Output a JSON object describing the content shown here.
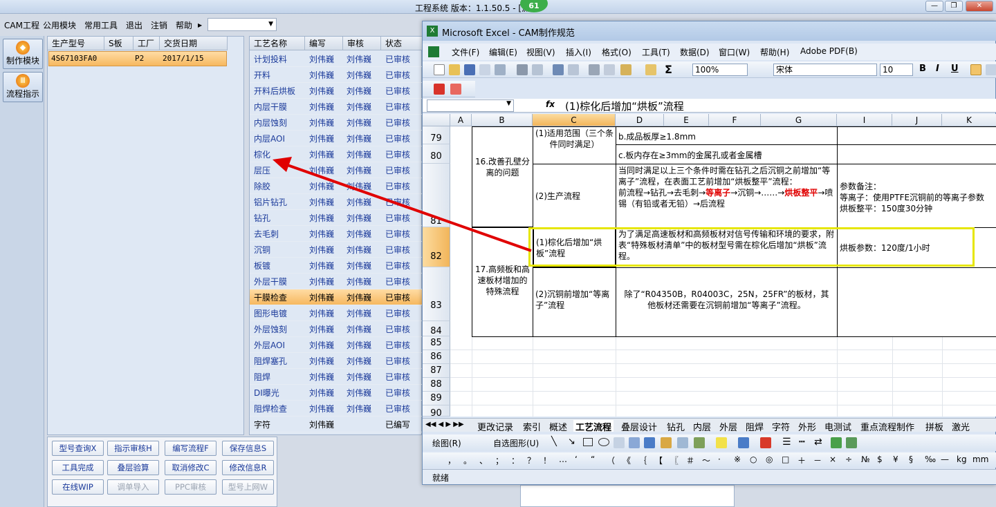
{
  "app": {
    "title": "工程系统 版本：1.1.50.5 - [流程",
    "badge": "61",
    "menu": [
      "CAM工程",
      "公用模块",
      "常用工具",
      "退出",
      "注销",
      "帮助"
    ],
    "nav": [
      "制作模块",
      "流程指示"
    ]
  },
  "parts": {
    "headers": [
      "生产型号",
      "S板",
      "工厂",
      "交货日期"
    ],
    "row": {
      "model": "4S67103FA0",
      "s": "",
      "factory": "P2",
      "date": "2017/1/15"
    }
  },
  "process": {
    "headers": [
      "工艺名称",
      "编写",
      "审核",
      "状态"
    ],
    "rows": [
      [
        "计划投料",
        "刘伟巍",
        "刘伟巍",
        "已审核"
      ],
      [
        "开料",
        "刘伟巍",
        "刘伟巍",
        "已审核"
      ],
      [
        "开料后烘板",
        "刘伟巍",
        "刘伟巍",
        "已审核"
      ],
      [
        "内层干膜",
        "刘伟巍",
        "刘伟巍",
        "已审核"
      ],
      [
        "内层蚀刻",
        "刘伟巍",
        "刘伟巍",
        "已审核"
      ],
      [
        "内层AOI",
        "刘伟巍",
        "刘伟巍",
        "已审核"
      ],
      [
        "棕化",
        "刘伟巍",
        "刘伟巍",
        "已审核"
      ],
      [
        "层压",
        "刘伟巍",
        "刘伟巍",
        "已审核"
      ],
      [
        "除胶",
        "刘伟巍",
        "刘伟巍",
        "已审核"
      ],
      [
        "铝片钻孔",
        "刘伟巍",
        "刘伟巍",
        "已审核"
      ],
      [
        "钻孔",
        "刘伟巍",
        "刘伟巍",
        "已审核"
      ],
      [
        "去毛刺",
        "刘伟巍",
        "刘伟巍",
        "已审核"
      ],
      [
        "沉铜",
        "刘伟巍",
        "刘伟巍",
        "已审核"
      ],
      [
        "板镀",
        "刘伟巍",
        "刘伟巍",
        "已审核"
      ],
      [
        "外层干膜",
        "刘伟巍",
        "刘伟巍",
        "已审核"
      ],
      [
        "干膜检查",
        "刘伟巍",
        "刘伟巍",
        "已审核"
      ],
      [
        "图形电镀",
        "刘伟巍",
        "刘伟巍",
        "已审核"
      ],
      [
        "外层蚀刻",
        "刘伟巍",
        "刘伟巍",
        "已审核"
      ],
      [
        "外层AOI",
        "刘伟巍",
        "刘伟巍",
        "已审核"
      ],
      [
        "阻焊塞孔",
        "刘伟巍",
        "刘伟巍",
        "已审核"
      ],
      [
        "阻焊",
        "刘伟巍",
        "刘伟巍",
        "已审核"
      ],
      [
        "DI曝光",
        "刘伟巍",
        "刘伟巍",
        "已审核"
      ],
      [
        "阻焊检查",
        "刘伟巍",
        "刘伟巍",
        "已审核"
      ],
      [
        "字符",
        "刘伟巍",
        "",
        "已编写"
      ]
    ]
  },
  "buttons": [
    [
      "型号查询X",
      "指示审核H",
      "编写流程F",
      "保存信息S"
    ],
    [
      "工具完成",
      "叠层验算",
      "取消修改C",
      "修改信息R"
    ],
    [
      "在线WIP",
      "调单导入",
      "PPC审核",
      "型号上网W"
    ]
  ],
  "excel": {
    "title": "Microsoft Excel - CAM制作规范",
    "menu": [
      "文件(F)",
      "编辑(E)",
      "视图(V)",
      "插入(I)",
      "格式(O)",
      "工具(T)",
      "数据(D)",
      "窗口(W)",
      "帮助(H)",
      "Adobe PDF(B)"
    ],
    "zoom": "100%",
    "font": "宋体",
    "size": "10",
    "formula": "(1)棕化后增加“烘板”流程",
    "columns": [
      "A",
      "B",
      "C",
      "D",
      "E",
      "F",
      "G",
      "I",
      "J",
      "K"
    ],
    "rows": [
      "79",
      "80",
      "81",
      "82",
      "83",
      "84",
      "85",
      "86",
      "87",
      "88",
      "89",
      "90"
    ],
    "cells": {
      "b79": "16.改善孔壁分离的问题",
      "c79": "(1)适用范围（三个条件同时满足）",
      "d79": "b.成品板厚≥1.8mm",
      "d80": "c.板内存在≥3mm的金属孔或者金属槽",
      "c81": "(2)生产流程",
      "d81a": "当同时满足以上三个条件时需在钻孔之后沉铜之前增加“等离子”流程，在表面工艺前增加“烘板整平”流程：",
      "d81b": "前流程→钻孔→去毛刺→",
      "d81c": "等离子",
      "d81d": "→沉铜→……→",
      "d81e": "烘板整平",
      "d81f": "→喷锡（有铅或者无铅）→后流程",
      "i81": "参数备注：\n等离子：使用PTFE沉铜前的等离子参数\n烘板整平：150度30分钟",
      "b82": "17.高频板和高速板材增加的特殊流程",
      "c82": "(1)棕化后增加“烘板”流程",
      "d82": "为了满足高速板材和高频板材对信号传输和环境的要求，附表“特殊板材清单”中的板材型号需在棕化后增加“烘板”流程。",
      "i82": "烘板参数：120度/1小时",
      "c83": "(2)沉铜前增加“等离子”流程",
      "d83": "除了“R04350B，R04003C，25N，25FR”的板材，其他板材还需要在沉铜前增加“等离子”流程。"
    },
    "sheets": [
      "更改记录",
      "索引",
      "概述",
      "工艺流程",
      "叠层设计",
      "钻孔",
      "内层",
      "外层",
      "阻焊",
      "字符",
      "外形",
      "电测试",
      "重点流程制作",
      "拼板",
      "激光"
    ],
    "draw": {
      "label": "绘图(R)",
      "autoshape": "自选图形(U)"
    },
    "symbols": [
      "，",
      "。",
      "、",
      "；",
      "：",
      "？",
      "！",
      "…",
      "‘",
      "“",
      "（",
      "《",
      "｛",
      "【",
      "〖",
      "＃",
      "～",
      "·",
      "※",
      "○",
      "◎",
      "□",
      "＋",
      "－",
      "×",
      "÷",
      "№",
      "$",
      "¥",
      "§",
      "‰",
      "—",
      "kg",
      "mm"
    ],
    "status": "就绪"
  },
  "colors": {
    "accent": "#1b3a9a",
    "highlight": "#f6b85f",
    "annotation": "#e00000",
    "selection": "#e6e600"
  }
}
